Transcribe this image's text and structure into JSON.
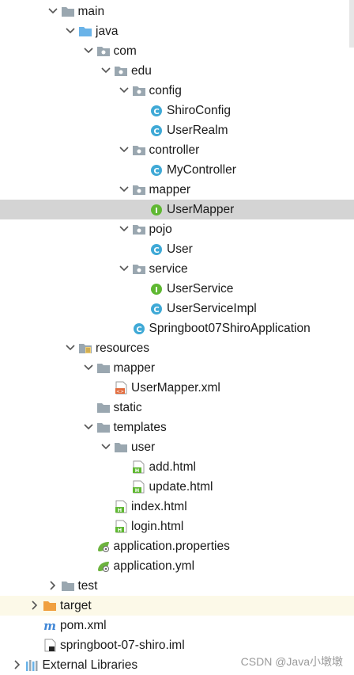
{
  "tree": [
    {
      "label": "main",
      "indent": 1,
      "type": "folder",
      "expanded": true
    },
    {
      "label": "java",
      "indent": 2,
      "type": "source-folder",
      "expanded": true
    },
    {
      "label": "com",
      "indent": 3,
      "type": "package",
      "expanded": true
    },
    {
      "label": "edu",
      "indent": 4,
      "type": "package",
      "expanded": true
    },
    {
      "label": "config",
      "indent": 5,
      "type": "package",
      "expanded": true
    },
    {
      "label": "ShiroConfig",
      "indent": 6,
      "type": "class"
    },
    {
      "label": "UserRealm",
      "indent": 6,
      "type": "class"
    },
    {
      "label": "controller",
      "indent": 5,
      "type": "package",
      "expanded": true
    },
    {
      "label": "MyController",
      "indent": 6,
      "type": "class"
    },
    {
      "label": "mapper",
      "indent": 5,
      "type": "package",
      "expanded": true
    },
    {
      "label": "UserMapper",
      "indent": 6,
      "type": "interface",
      "selected": true
    },
    {
      "label": "pojo",
      "indent": 5,
      "type": "package",
      "expanded": true
    },
    {
      "label": "User",
      "indent": 6,
      "type": "class"
    },
    {
      "label": "service",
      "indent": 5,
      "type": "package",
      "expanded": true
    },
    {
      "label": "UserService",
      "indent": 6,
      "type": "interface"
    },
    {
      "label": "UserServiceImpl",
      "indent": 6,
      "type": "class"
    },
    {
      "label": "Springboot07ShiroApplication",
      "indent": 5,
      "type": "spring-class"
    },
    {
      "label": "resources",
      "indent": 2,
      "type": "resources-folder",
      "expanded": true
    },
    {
      "label": "mapper",
      "indent": 3,
      "type": "folder",
      "expanded": true
    },
    {
      "label": "UserMapper.xml",
      "indent": 4,
      "type": "xml"
    },
    {
      "label": "static",
      "indent": 3,
      "type": "folder"
    },
    {
      "label": "templates",
      "indent": 3,
      "type": "folder",
      "expanded": true
    },
    {
      "label": "user",
      "indent": 4,
      "type": "folder",
      "expanded": true
    },
    {
      "label": "add.html",
      "indent": 5,
      "type": "html"
    },
    {
      "label": "update.html",
      "indent": 5,
      "type": "html"
    },
    {
      "label": "index.html",
      "indent": 4,
      "type": "html"
    },
    {
      "label": "login.html",
      "indent": 4,
      "type": "html"
    },
    {
      "label": "application.properties",
      "indent": 3,
      "type": "spring-config"
    },
    {
      "label": "application.yml",
      "indent": 3,
      "type": "spring-config"
    },
    {
      "label": "test",
      "indent": 1,
      "type": "folder",
      "expanded": false
    },
    {
      "label": "target",
      "indent": 0,
      "type": "excluded-folder",
      "expanded": false,
      "highlight": true
    },
    {
      "label": "pom.xml",
      "indent": 0,
      "type": "maven"
    },
    {
      "label": "springboot-07-shiro.iml",
      "indent": 0,
      "type": "iml"
    },
    {
      "label": "External Libraries",
      "indent": -1,
      "type": "libraries",
      "expanded": false
    }
  ],
  "watermark": "CSDN @Java小墩墩",
  "colors": {
    "selected_bg": "#d4d4d4",
    "highlight_bg": "#fcf9e8",
    "folder": "#9aa7b0",
    "source_folder": "#6ab3e8",
    "class_icon": "#3fa9d6",
    "interface_icon": "#5fb832",
    "excluded_folder": "#f0a040",
    "spring_green": "#6db33f"
  }
}
